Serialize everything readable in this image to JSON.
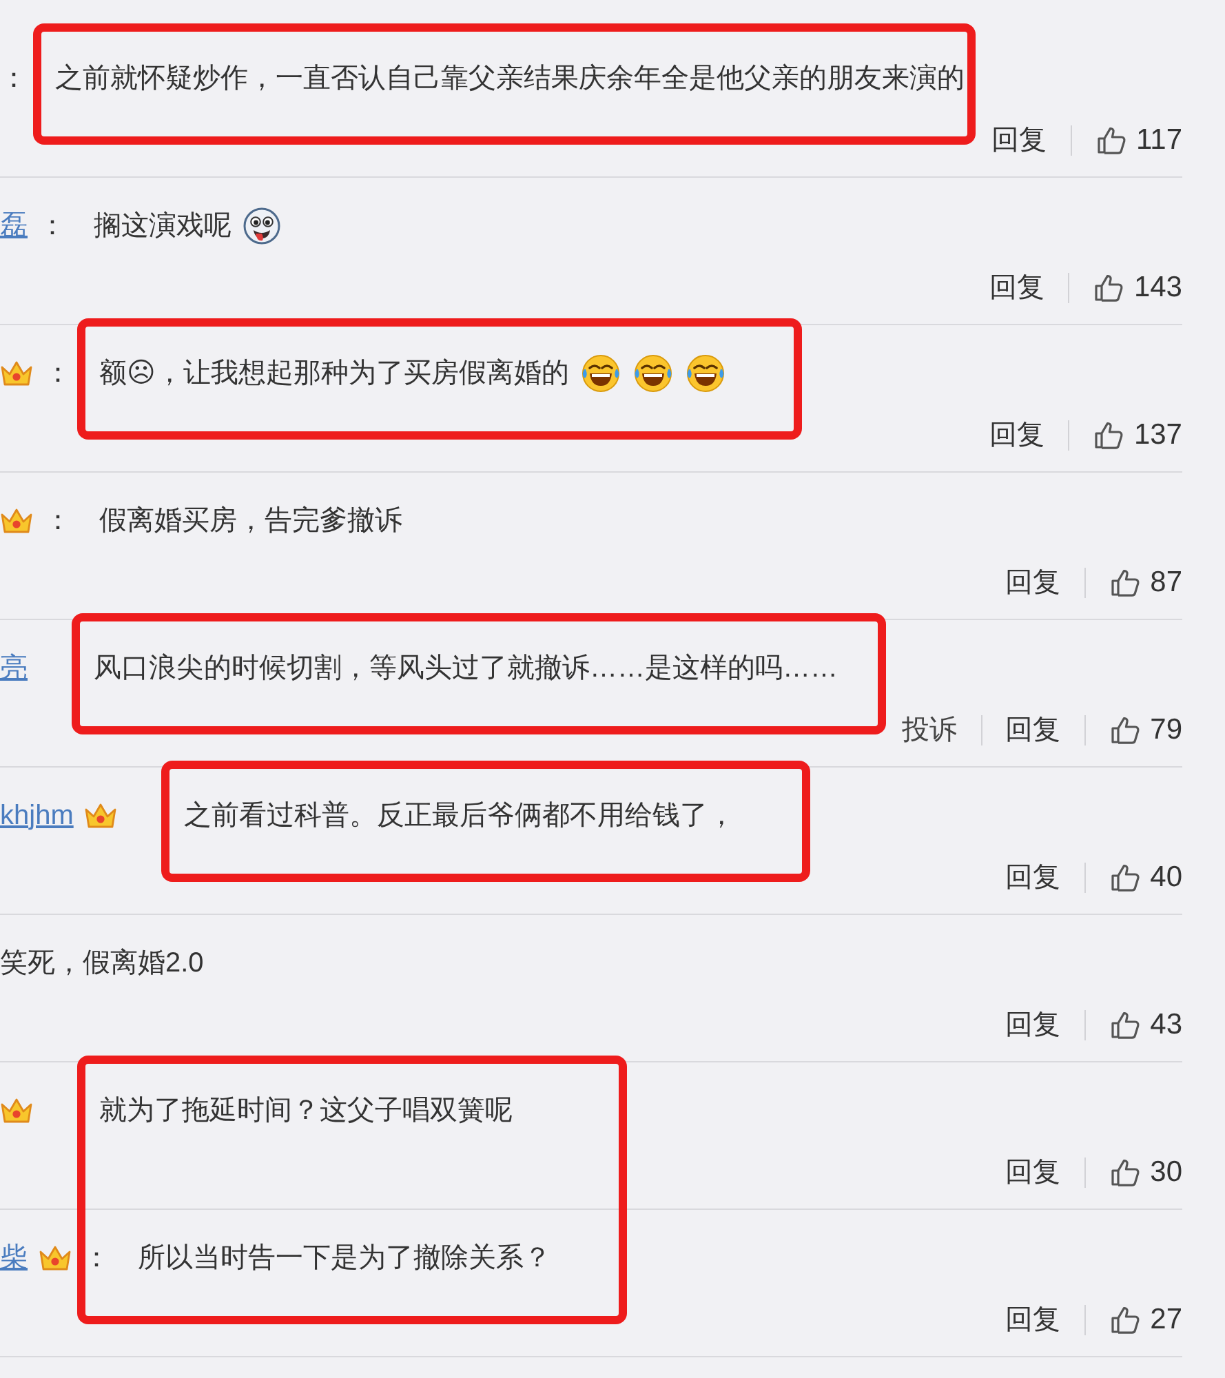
{
  "groups": [
    {
      "highlighted": true,
      "comments": [
        {
          "vip": false,
          "separator": "：",
          "text": "之前就怀疑炒作，一直否认自己靠父亲结果庆余年全是他父亲的朋友来演的",
          "reply": "回复",
          "likes": "117"
        }
      ]
    },
    {
      "highlighted": false,
      "comments": [
        {
          "author": "磊",
          "vip": false,
          "separator": "：",
          "text": "搁这演戏呢",
          "stickers": [
            {
              "kind": "tongue"
            }
          ],
          "reply": "回复",
          "likes": "143"
        }
      ]
    },
    {
      "highlighted": true,
      "comments": [
        {
          "vip": true,
          "separator": "：",
          "text": "额☹，让我想起那种为了买房假离婚的",
          "stickers": [
            {
              "kind": "laugh"
            },
            {
              "kind": "laugh"
            },
            {
              "kind": "laugh"
            }
          ],
          "reply": "回复",
          "likes": "137"
        }
      ]
    },
    {
      "highlighted": false,
      "comments": [
        {
          "vip": true,
          "separator": "：",
          "text": "假离婚买房，告完爹撤诉",
          "reply": "回复",
          "likes": "87"
        }
      ]
    },
    {
      "highlighted": true,
      "comments": [
        {
          "author": "亮",
          "vip": false,
          "text": "风口浪尖的时候切割，等风头过了就撤诉……是这样的吗……",
          "report": "投诉",
          "reply": "回复",
          "likes": "79"
        }
      ]
    },
    {
      "highlighted": true,
      "comments": [
        {
          "author": "khjhm",
          "vip": true,
          "text": "之前看过科普。反正最后爷俩都不用给钱了，",
          "reply": "回复",
          "likes": "40"
        }
      ]
    },
    {
      "highlighted": false,
      "comments": [
        {
          "vip": false,
          "text": "笑死，假离婚2.0",
          "reply": "回复",
          "likes": "43"
        }
      ]
    },
    {
      "highlighted": true,
      "comments": [
        {
          "vip": true,
          "text": "就为了拖延时间？这父子唱双簧呢",
          "reply": "回复",
          "likes": "30"
        },
        {
          "author": "柴",
          "vip": true,
          "separator": "：",
          "text": "所以当时告一下是为了撤除关系？",
          "reply": "回复",
          "likes": "27"
        }
      ]
    }
  ]
}
